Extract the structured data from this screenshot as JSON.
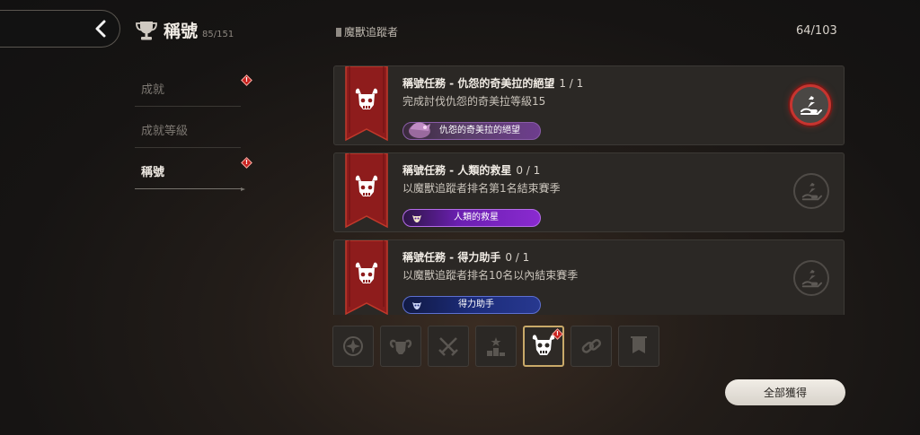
{
  "header": {
    "title": "稱號",
    "count": "85/151"
  },
  "menu": {
    "items": [
      {
        "label": "成就",
        "alert": "!"
      },
      {
        "label": "成就等級"
      },
      {
        "label": "稱號",
        "alert": "!"
      }
    ]
  },
  "section": {
    "label": "魔獸追蹤者",
    "progress": "64/103"
  },
  "quests": [
    {
      "title": "稱號任務 - 仇怨的奇美拉的絕望",
      "progress": "1 / 1",
      "desc": "完成討伐仇怨的奇美拉等級15",
      "tag": "仇怨的奇美拉的絕望",
      "claimable": true
    },
    {
      "title": "稱號任務 - 人類的救星",
      "progress": "0 / 1",
      "desc": "以魔獸追蹤者排名第1名結束賽季",
      "tag": "人類的救星",
      "claimable": false
    },
    {
      "title": "稱號任務 - 得力助手",
      "progress": "0 / 1",
      "desc": "以魔獸追蹤者排名10名以內結束賽季",
      "tag": "得力助手",
      "claimable": false
    }
  ],
  "filters": [
    {
      "icon": "emblem-icon"
    },
    {
      "icon": "ram-skull-icon"
    },
    {
      "icon": "crossed-swords-icon"
    },
    {
      "icon": "podium-icon"
    },
    {
      "icon": "bull-skull-icon",
      "selected": true,
      "alert": "!"
    },
    {
      "icon": "chain-link-icon"
    },
    {
      "icon": "banner-icon"
    }
  ],
  "actions": {
    "claim_all": "全部獲得"
  },
  "colors": {
    "accent_red": "#c8342f",
    "banner_red": "#8e1c1c",
    "selected_border": "#c9a969"
  }
}
